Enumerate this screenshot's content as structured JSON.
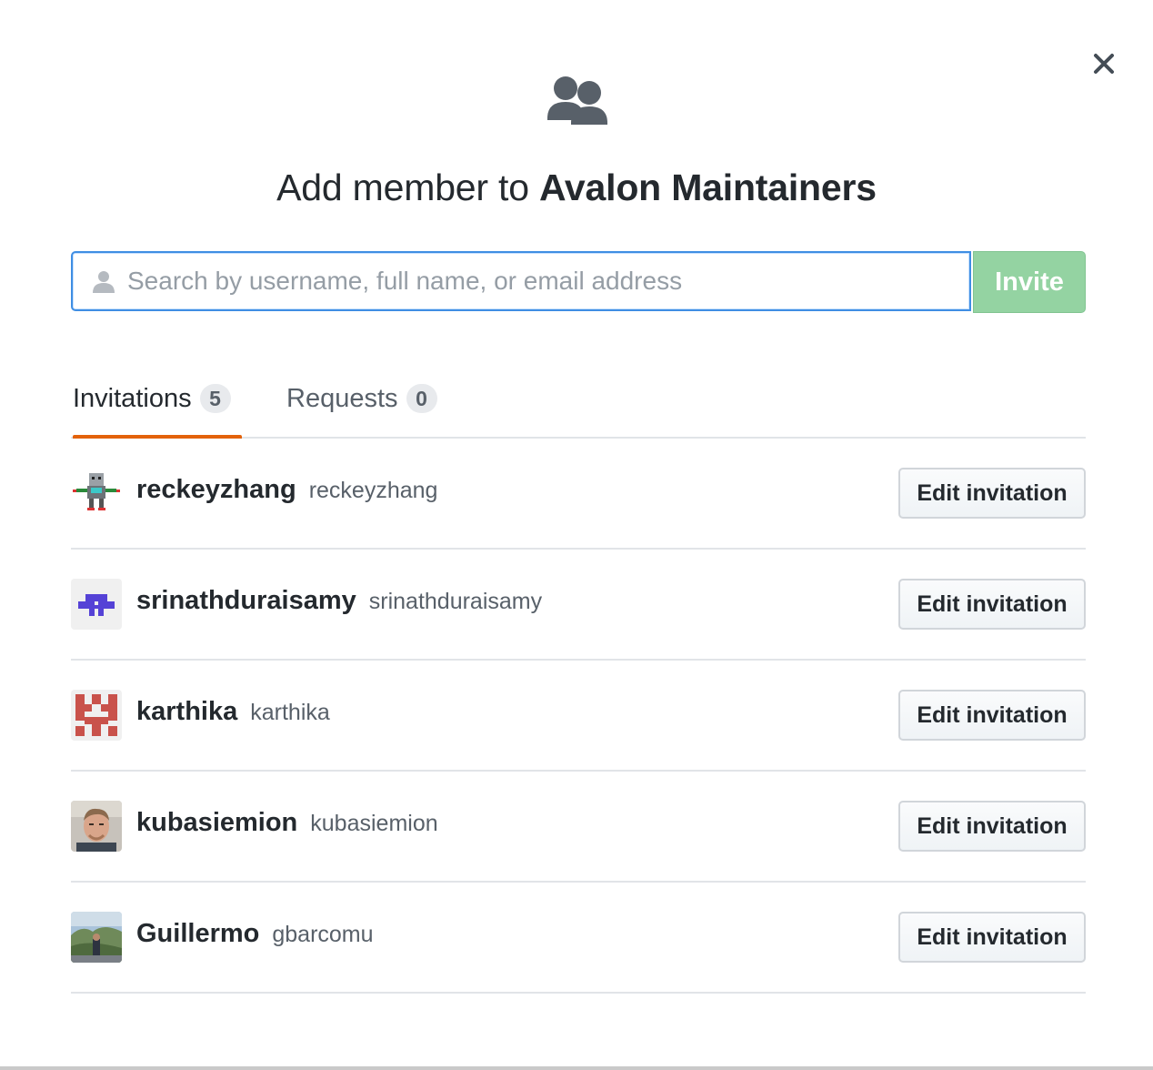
{
  "dialog": {
    "close_icon": "close-icon",
    "header_icon": "people-icon",
    "title_prefix": "Add member to",
    "team_name": "Avalon Maintainers"
  },
  "search": {
    "placeholder": "Search by username, full name, or email address",
    "value": "",
    "icon": "person-icon"
  },
  "invite_button": {
    "label": "Invite",
    "color": "#94d3a2",
    "enabled": false
  },
  "tabs": [
    {
      "label": "Invitations",
      "count": "5",
      "selected": true
    },
    {
      "label": "Requests",
      "count": "0",
      "selected": false
    }
  ],
  "accent_color": "#e36209",
  "invitations": [
    {
      "name": "reckeyzhang",
      "login": "reckeyzhang",
      "avatar": "robot-avatar",
      "action": "Edit invitation"
    },
    {
      "name": "srinathduraisamy",
      "login": "srinathduraisamy",
      "avatar": "identicon-purple",
      "action": "Edit invitation"
    },
    {
      "name": "karthika",
      "login": "karthika",
      "avatar": "identicon-red",
      "action": "Edit invitation"
    },
    {
      "name": "kubasiemion",
      "login": "kubasiemion",
      "avatar": "photo-portrait",
      "action": "Edit invitation"
    },
    {
      "name": "Guillermo",
      "login": "gbarcomu",
      "avatar": "photo-landscape",
      "action": "Edit invitation"
    }
  ]
}
